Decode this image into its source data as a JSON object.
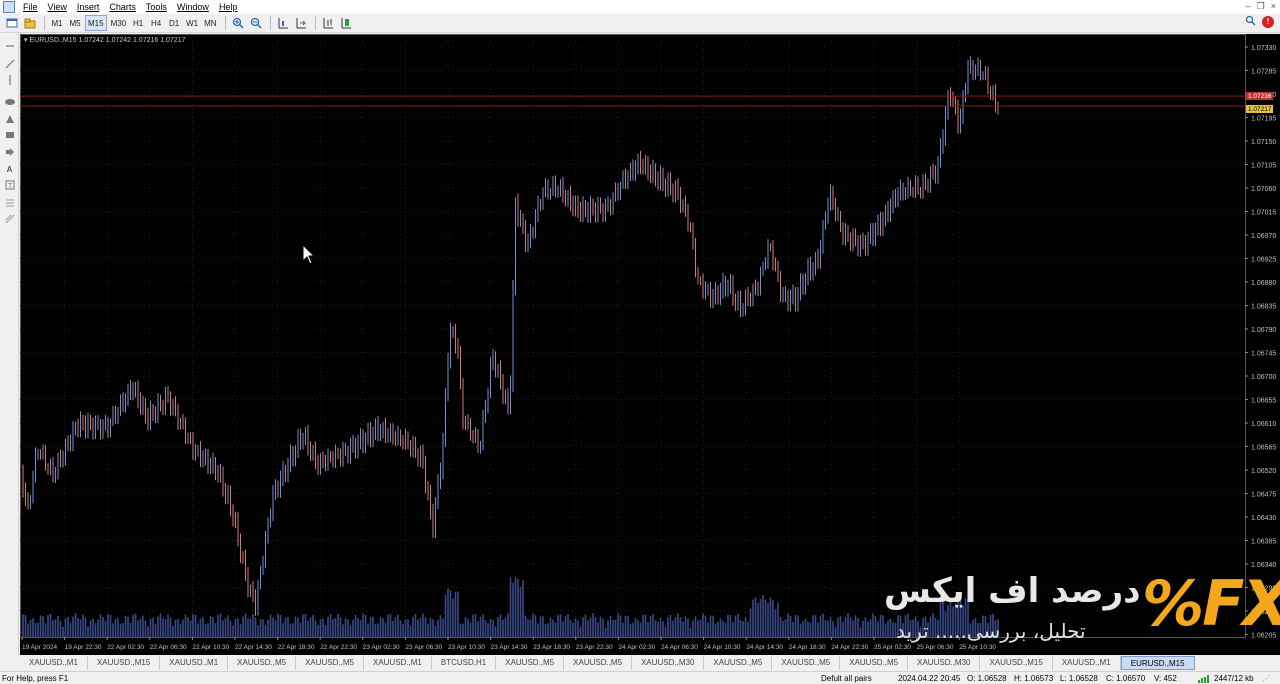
{
  "menu": [
    "File",
    "View",
    "Insert",
    "Charts",
    "Tools",
    "Window",
    "Help"
  ],
  "timeframes": [
    "M1",
    "M5",
    "M15",
    "M30",
    "H1",
    "H4",
    "D1",
    "W1",
    "MN"
  ],
  "active_timeframe": "M15",
  "chart": {
    "header": "EURUSD.,M15  1.07242 1.07242 1.07216 1.07217",
    "price_labels": [
      "1.07330",
      "1.07285",
      "1.07240",
      "1.07195",
      "1.07150",
      "1.07105",
      "1.07060",
      "1.07015",
      "1.06970",
      "1.06925",
      "1.06880",
      "1.06835",
      "1.06790",
      "1.06745",
      "1.06700",
      "1.06655",
      "1.06610",
      "1.06565",
      "1.06520",
      "1.06475",
      "1.06430",
      "1.06385",
      "1.06340",
      "1.06295",
      "1.06250",
      "1.06205"
    ],
    "current_price": "1.07217",
    "ask_price": "1.07236",
    "time_labels": [
      "19 Apr 2024",
      "19 Apr 22:30",
      "22 Apr 02:30",
      "22 Apr 06:30",
      "22 Apr 10:30",
      "22 Apr 14:30",
      "22 Apr 18:30",
      "22 Apr 22:30",
      "23 Apr 02:30",
      "23 Apr 06:30",
      "23 Apr 10:30",
      "23 Apr 14:30",
      "23 Apr 18:30",
      "23 Apr 22:30",
      "24 Apr 02:30",
      "24 Apr 06:30",
      "24 Apr 10:30",
      "24 Apr 14:30",
      "24 Apr 18:30",
      "24 Apr 22:30",
      "25 Apr 02:30",
      "25 Apr 06:30",
      "25 Apr 10:30"
    ],
    "bull_color": "#6d8fd8",
    "bear_color": "#d07a74",
    "hline_color": "#8a1a1a"
  },
  "logo": {
    "brand": "%FX",
    "title": "درصد اف ایکس",
    "subtitle": "تحلیل، بررسی..... ترید"
  },
  "tabs": [
    "XAUUSD.,M1",
    "XAUUSD.,M15",
    "XAUUSD.,M1",
    "XAUUSD.,M5",
    "XAUUSD.,M5",
    "XAUUSD.,M1",
    "BTCUSD,H1",
    "XAUUSD.,M5",
    "XAUUSD.,M5",
    "XAUUSD.,M30",
    "XAUUSD.,M5",
    "XAUUSD.,M5",
    "XAUUSD.,M5",
    "XAUUSD.,M30",
    "XAUUSD.,M15",
    "XAUUSD.,M1",
    "EURUSD.,M15"
  ],
  "active_tab": 16,
  "status": {
    "help": "For Help, press F1",
    "profile": "Defult all pairs",
    "datetime": "2024.04.22 20:45",
    "open": "O: 1.06528",
    "high": "H: 1.06573",
    "low": "L: 1.06528",
    "close": "C: 1.06570",
    "volume": "V: 452",
    "traffic": "2447/12 kb"
  }
}
